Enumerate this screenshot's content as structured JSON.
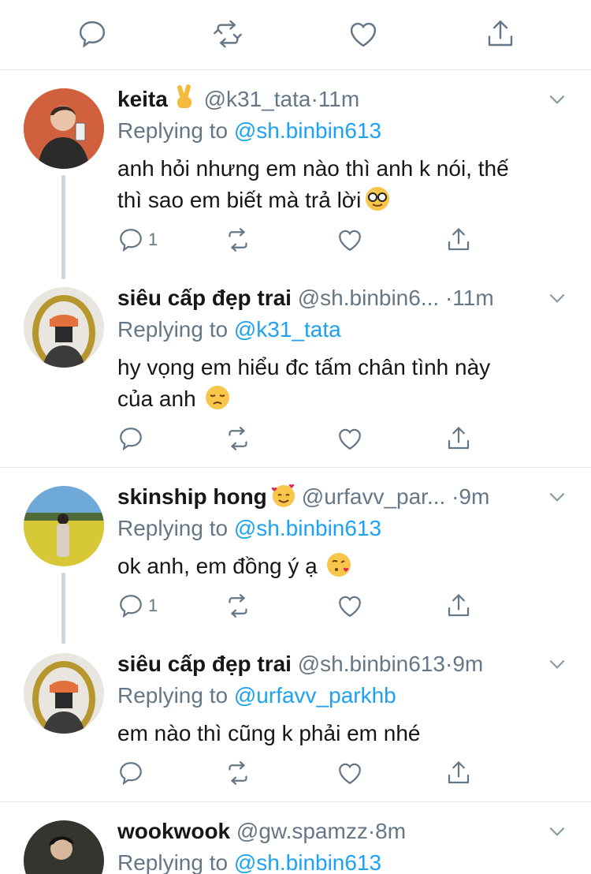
{
  "top_actions": [
    "reply-icon",
    "retweet-icon",
    "like-icon",
    "share-icon"
  ],
  "tweets": [
    {
      "name": "keita",
      "handle": "@k31_tata",
      "time": "11m",
      "replying_label": "Replying to",
      "replying_to": "@sh.binbin613",
      "text_lines": [
        "anh hỏi nhưng em nào thì anh k nói, thế",
        "thì sao em biết mà trả lời"
      ],
      "reply_count": "1"
    },
    {
      "name": "siêu cấp đẹp trai",
      "handle": "@sh.binbin6...",
      "time": "11m",
      "replying_label": "Replying to",
      "replying_to": "@k31_tata",
      "text_lines": [
        "hy vọng em hiểu đc tấm chân tình này",
        "của anh"
      ],
      "reply_count": ""
    },
    {
      "name": "skinship hong",
      "handle": "@urfavv_par...",
      "time": "9m",
      "replying_label": "Replying to",
      "replying_to": "@sh.binbin613",
      "text_lines": [
        "ok anh, em đồng ý ạ"
      ],
      "reply_count": "1"
    },
    {
      "name": "siêu cấp đẹp trai",
      "handle": "@sh.binbin613",
      "time": "9m",
      "replying_label": "Replying to",
      "replying_to": "@urfavv_parkhb",
      "text_lines": [
        "em nào thì cũng k phải em nhé"
      ],
      "reply_count": ""
    },
    {
      "name": "wookwook",
      "handle": "@gw.spamzz",
      "time": "8m",
      "replying_label": "Replying to",
      "replying_to": "@sh.binbin613",
      "text_lines": [],
      "reply_count": ""
    }
  ],
  "dot": "·",
  "colors": {
    "link": "#1da1f2",
    "muted": "#657786",
    "divider": "#e1e8ed",
    "thread_line": "#ccd6dd"
  }
}
